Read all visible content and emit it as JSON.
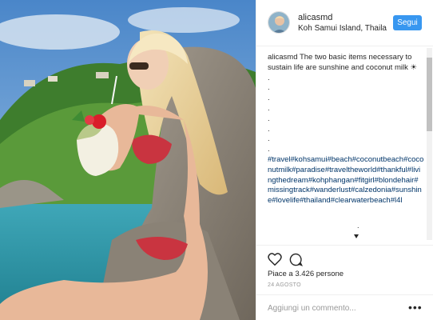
{
  "post": {
    "username": "alicasmd",
    "location": "Koh Samui Island, Thaila...",
    "follow_label": "Segui",
    "caption_user": "alicasmd",
    "caption_text": "The two basic items necessary to sustain life are sunshine and coconut milk ☀",
    "caption_dots": [
      ".",
      ".",
      ".",
      ".",
      ".",
      ".",
      ".",
      "."
    ],
    "hashtags": "#travel#kohsamui#beach#coconutbeach#coconutmilk#paradise#traveltheworld#thankful#livingthedream#kohphangan#fitgirl#blondehair#missingtrack#wanderlust#calzedonia#sunshine#lovelife#thailand#clearwaterbeach#l4l",
    "trailing_dot": ".",
    "likes": "Piace a 3.426 persone",
    "date": "24 AGOSTO",
    "comment_placeholder": "Aggiungi un commento...",
    "more_options": "•••"
  },
  "icons": {
    "like": "heart-icon",
    "comment": "comment-icon",
    "load_more": "chevron-down-icon"
  },
  "colors": {
    "follow_button": "#3897f0",
    "hashtag": "#003569",
    "text": "#262626",
    "muted": "#999999"
  }
}
